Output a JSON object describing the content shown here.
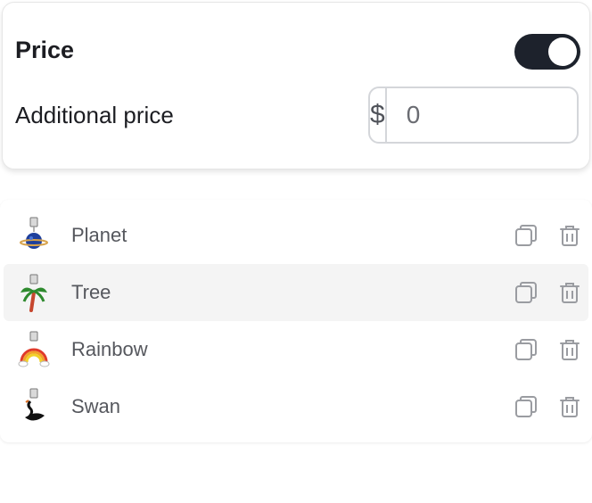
{
  "price_section": {
    "title": "Price",
    "toggle_on": true,
    "additional_label": "Additional price",
    "currency": "$",
    "amount_value": "0"
  },
  "charms": [
    {
      "label": "Planet",
      "icon": "planet-charm-icon",
      "selected": false
    },
    {
      "label": "Tree",
      "icon": "palm-tree-charm-icon",
      "selected": true
    },
    {
      "label": "Rainbow",
      "icon": "rainbow-charm-icon",
      "selected": false
    },
    {
      "label": "Swan",
      "icon": "swan-charm-icon",
      "selected": false
    }
  ],
  "row_actions": {
    "copy_icon": "copy-icon",
    "delete_icon": "trash-icon"
  },
  "colors": {
    "toggle_on": "#1d222c",
    "selected_row": "#f4f4f4"
  }
}
